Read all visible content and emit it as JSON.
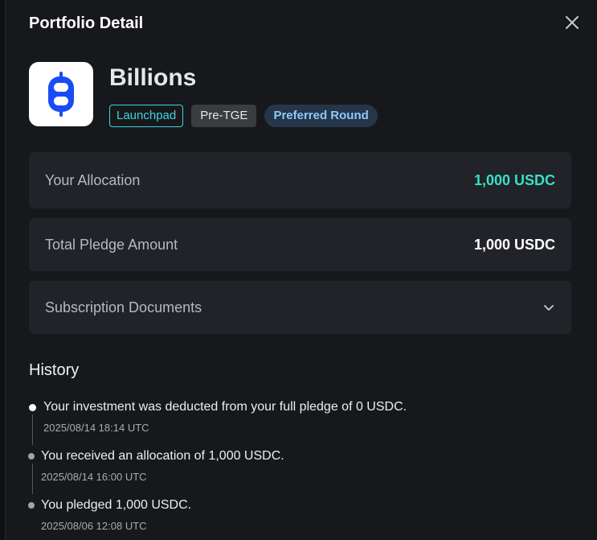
{
  "header": {
    "title": "Portfolio Detail"
  },
  "icons": {
    "close": "close-icon",
    "chevron": "chevron-down-icon",
    "logo": "billions-logo"
  },
  "colors": {
    "accent": "#37e0c8",
    "launchpad": "#3fd4e0",
    "logo_blue": "#1a4cf5"
  },
  "project": {
    "name": "Billions",
    "tags": {
      "launchpad": "Launchpad",
      "stage": "Pre-TGE",
      "round": "Preferred Round"
    }
  },
  "allocation": {
    "label": "Your Allocation",
    "value": "1,000 USDC"
  },
  "pledge": {
    "label": "Total Pledge Amount",
    "value": "1,000 USDC"
  },
  "documents": {
    "label": "Subscription Documents"
  },
  "history": {
    "title": "History",
    "events": [
      {
        "text": "Your investment was deducted from your full pledge of 0 USDC.",
        "time": "2025/08/14 18:14 UTC"
      },
      {
        "text": "You received an allocation of 1,000 USDC.",
        "time": "2025/08/14 16:00 UTC"
      },
      {
        "text": "You pledged 1,000 USDC.",
        "time": "2025/08/06 12:08 UTC"
      }
    ]
  }
}
